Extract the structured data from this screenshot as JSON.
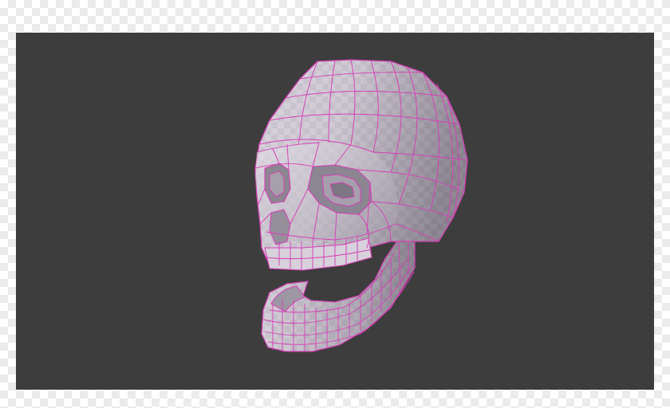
{
  "scene": {
    "subject_icon": "skull-icon",
    "viewport_color": "#3d3d3d",
    "wire_color": "#d63fb6",
    "mesh_light": "#e2dde6",
    "mesh_mid": "#b7b0bd",
    "mesh_dark": "#7a727f",
    "page_background": "checkerboard"
  }
}
